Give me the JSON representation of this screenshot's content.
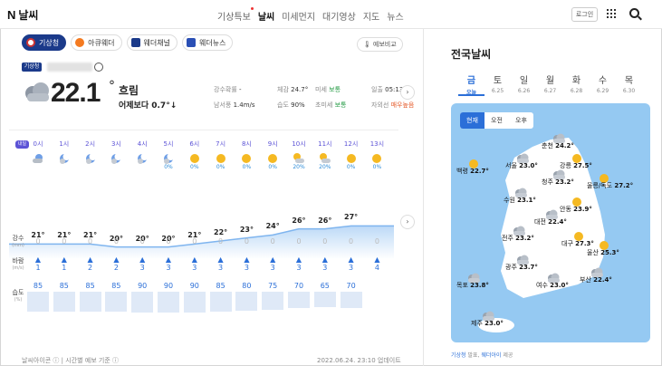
{
  "header": {
    "logo": "N",
    "title": "날씨",
    "nav": [
      "기상특보",
      "날씨",
      "미세먼지",
      "대기영상",
      "지도",
      "뉴스"
    ],
    "active_nav": "날씨",
    "login": "로그인"
  },
  "tabs": [
    "기상청",
    "아큐웨더",
    "웨더채널",
    "웨더뉴스"
  ],
  "forecast_compare": "예보비교",
  "source_badge": "기상청",
  "current": {
    "temp": "22.1",
    "unit": "°",
    "condition": "흐림",
    "compare": "어제보다 0.7°↓"
  },
  "stats": {
    "rain_prob_label": "강수확률",
    "rain_prob": "-",
    "feels_label": "체감",
    "feels": "24.7°",
    "dust_label": "미세",
    "dust": "보통",
    "sunrise_label": "일출",
    "sunrise": "05:13",
    "wind_label": "남서풍",
    "wind": "1.4m/s",
    "humidity_label": "습도",
    "humidity": "90%",
    "ultra_label": "초미세",
    "ultra": "보통",
    "uv_label": "자외선",
    "uv": "매우높음"
  },
  "hourly": {
    "today_label": "내일",
    "hours": [
      "0시",
      "1시",
      "2시",
      "3시",
      "4시",
      "5시",
      "6시",
      "7시",
      "8시",
      "9시",
      "10시",
      "11시",
      "12시",
      "13시"
    ],
    "precip_prob": [
      "",
      "",
      "",
      "",
      "",
      "0%",
      "0%",
      "0%",
      "0%",
      "0%",
      "20%",
      "20%",
      "0%",
      "0%"
    ],
    "temps": [
      "21°",
      "21°",
      "21°",
      "20°",
      "20°",
      "20°",
      "21°",
      "22°",
      "23°",
      "24°",
      "26°",
      "26°",
      "27°"
    ],
    "rain_label": "강수",
    "rain_unit": "(mm)",
    "rain": [
      "0",
      "0",
      "0",
      "0",
      "0",
      "0",
      "0",
      "0",
      "0",
      "0",
      "0",
      "0",
      "0",
      "0"
    ],
    "wind_label": "바람",
    "wind_unit": "(m/s)",
    "wind": [
      "1",
      "1",
      "2",
      "2",
      "3",
      "3",
      "3",
      "3",
      "3",
      "3",
      "3",
      "3",
      "3",
      "4"
    ],
    "hum_label": "습도",
    "hum_unit": "(%)",
    "humidity": [
      "85",
      "85",
      "85",
      "85",
      "90",
      "90",
      "90",
      "85",
      "80",
      "75",
      "70",
      "65",
      "70"
    ]
  },
  "footer": {
    "icon_note": "날씨아이콘",
    "hourly_note": "시간별 예보 기준",
    "updated": "2022.06.24. 23:10 업데이트"
  },
  "national": {
    "title": "전국날씨",
    "days": [
      {
        "day": "금",
        "date": "오늘"
      },
      {
        "day": "토",
        "date": "6.25"
      },
      {
        "day": "일",
        "date": "6.26"
      },
      {
        "day": "월",
        "date": "6.27"
      },
      {
        "day": "화",
        "date": "6.28"
      },
      {
        "day": "수",
        "date": "6.29"
      },
      {
        "day": "목",
        "date": "6.30"
      }
    ],
    "map_tabs": [
      "현재",
      "오전",
      "오후"
    ],
    "cities": [
      {
        "name": "춘천",
        "temp": "24.2°"
      },
      {
        "name": "백령",
        "temp": "22.7°"
      },
      {
        "name": "서울",
        "temp": "23.0°"
      },
      {
        "name": "강릉",
        "temp": "27.5°"
      },
      {
        "name": "울릉/독도",
        "temp": "27.2°"
      },
      {
        "name": "청주",
        "temp": "23.2°"
      },
      {
        "name": "수원",
        "temp": "23.1°"
      },
      {
        "name": "안동",
        "temp": "23.9°"
      },
      {
        "name": "대전",
        "temp": "22.4°"
      },
      {
        "name": "전주",
        "temp": "23.2°"
      },
      {
        "name": "대구",
        "temp": "27.3°"
      },
      {
        "name": "울산",
        "temp": "25.3°"
      },
      {
        "name": "광주",
        "temp": "23.7°"
      },
      {
        "name": "목포",
        "temp": "23.8°"
      },
      {
        "name": "여수",
        "temp": "23.0°"
      },
      {
        "name": "부산",
        "temp": "22.4°"
      },
      {
        "name": "제주",
        "temp": "23.0°"
      }
    ],
    "source_a": "기상청",
    "source_b": "웨더아이",
    "source_suffix": "제공",
    "source_mid": "발표,"
  }
}
